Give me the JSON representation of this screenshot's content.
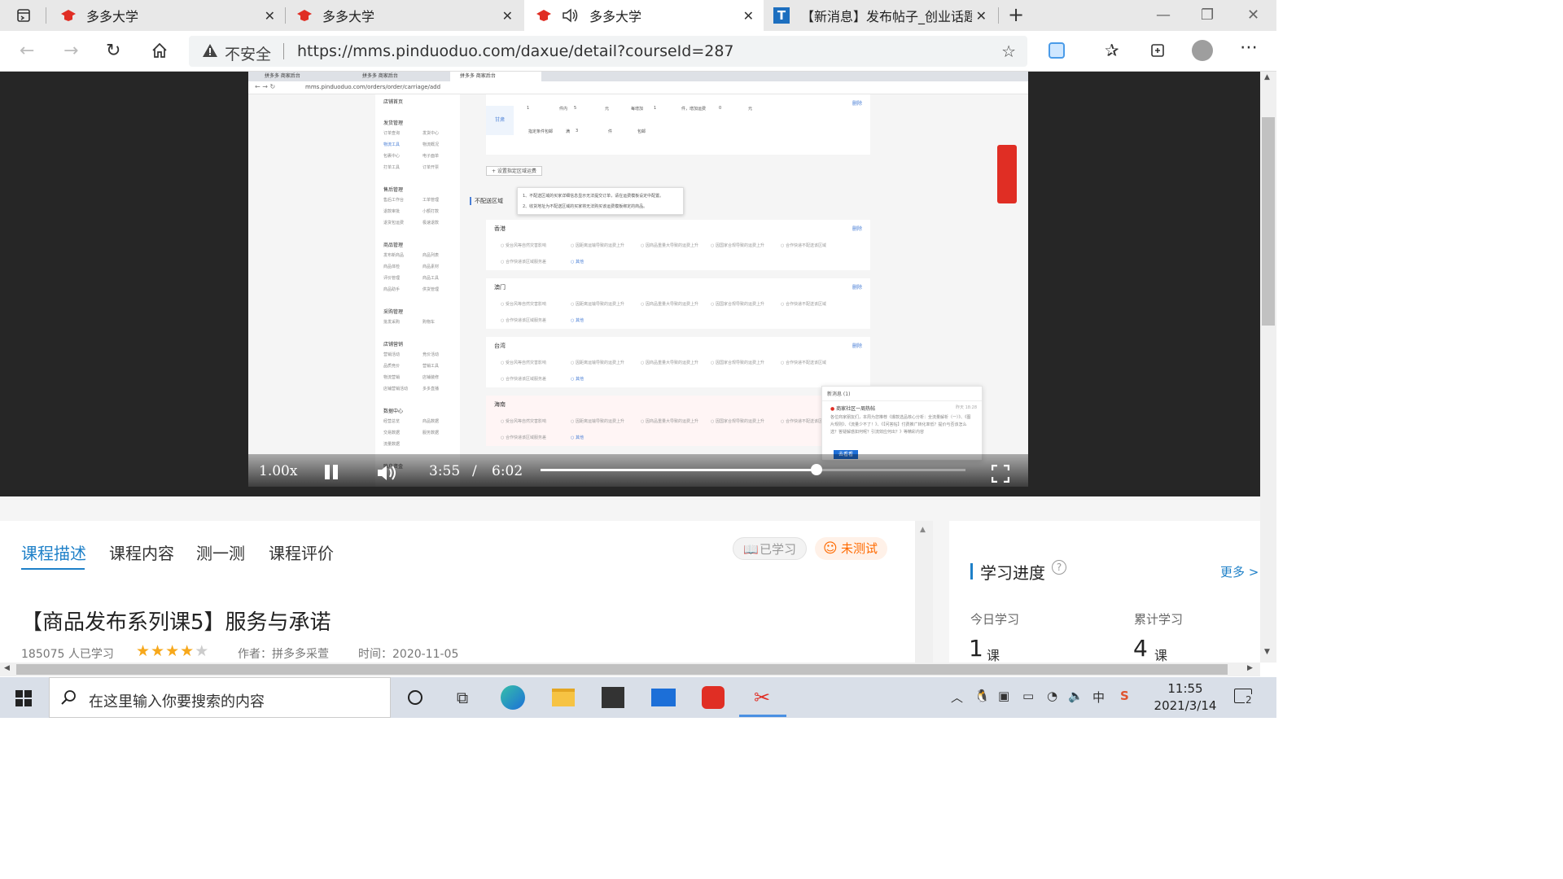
{
  "browser": {
    "tabs": [
      {
        "title": "多多大学",
        "active": false
      },
      {
        "title": "多多大学",
        "active": false
      },
      {
        "title": "多多大学",
        "active": true,
        "audio": true
      },
      {
        "title": "【新消息】发布帖子_创业话题_|",
        "active": false
      }
    ],
    "security_label": "不安全",
    "url": "https://mms.pinduoduo.com/daxue/detail?courseId=287"
  },
  "video": {
    "speed": "1.00x",
    "current_time": "3:55",
    "separator": "/",
    "duration": "6:02",
    "progress": 0.65,
    "screenshot": {
      "tabs": [
        "拼多多 商家后台",
        "拼多多 商家后台",
        "拼多多 商家后台"
      ],
      "url": "mms.pinduoduo.com/orders/order/carriage/add",
      "sidebar": [
        {
          "heading": "店铺首页",
          "items": []
        },
        {
          "heading": "发货管理",
          "items": [
            "订单查询",
            "发货中心",
            "物流工具",
            "物流概况",
            "包裹中心",
            "电子面单",
            "打单工具",
            "订单开票"
          ]
        },
        {
          "heading": "售后管理",
          "items": [
            "售后工作台",
            "工单管理",
            "退款审批",
            "小额打款",
            "退货包运费",
            "极速退款"
          ]
        },
        {
          "heading": "商品管理",
          "items": [
            "发布新商品",
            "商品列表",
            "商品体检",
            "商品素材",
            "评价管理",
            "商品工具",
            "商品助手",
            "供货管理"
          ]
        },
        {
          "heading": "采购管理",
          "items": [
            "批发采购",
            "购物车"
          ]
        },
        {
          "heading": "店铺营销",
          "items": [
            "营销活动",
            "竞价活动",
            "品质竞价",
            "营销工具",
            "物流营销",
            "店铺装修",
            "店铺营销活动",
            "多多直播"
          ]
        },
        {
          "heading": "数据中心",
          "items": [
            "经营总览",
            "商品数据",
            "交易数据",
            "服务数据",
            "流量数据"
          ]
        },
        {
          "heading": "账户资金",
          "items": []
        }
      ],
      "top_card": {
        "region": "甘肃",
        "piece_within": "件内",
        "each_add": "每增加",
        "piece_add_fee": "件，增加运费",
        "yuan": "元",
        "min_pieces": "1",
        "first_fee": "5",
        "add_pieces": "1",
        "add_fee": "0",
        "free_condition": "指定条件包邮",
        "full": "满",
        "full_value": "3",
        "unit": "件",
        "free_label": "包邮",
        "delete": "删除"
      },
      "add_region_button": "+ 设置指定区域运费",
      "no_delivery_label": "不配送区域",
      "tooltip": [
        "1、不配送区域的买家详细信息显示无法提交订单，请在运费模板设定中配置。",
        "2、收货地址为不配送区域的买家将无法购买该运费模板绑定的商品。"
      ],
      "options": [
        "受台风等自然灾害影响",
        "因距离运输导致的运费上升",
        "因商品重量大导致的运费上升",
        "因国家合规导致的运费上升",
        "合作快递不配送该区域",
        "合作快递该区域服务差",
        "其他"
      ],
      "regions": [
        {
          "name": "香港",
          "delete": "删除"
        },
        {
          "name": "澳门",
          "delete": "删除"
        },
        {
          "name": "台湾",
          "delete": "删除"
        },
        {
          "name": "海南",
          "delete": "删除"
        }
      ],
      "notice": {
        "title": "新消息 (1)",
        "item_title": "商家社区一周热帖",
        "item_time": "昨天 18:28",
        "body": "各位商家朋友们，本周为您推荐《爆款选品核心分析：全流量解析（一）》、《图片规则》、《流量少不了！》、《【问答帖】付费推广转化率低？提价与否该怎么选？答疑解惑如何呢？引流效应何出？》等精彩内容",
        "button": "去看看"
      }
    }
  },
  "course": {
    "tabs": [
      "课程描述",
      "课程内容",
      "测一测",
      "课程评价"
    ],
    "learned_label": "已学习",
    "test_label": "未测试",
    "title": "【商品发布系列课5】服务与承诺",
    "learners": "185075 人已学习",
    "rating": 4,
    "author": "作者：拼多多采萱",
    "time": "时间：2020-11-05"
  },
  "progress_panel": {
    "title": "学习进度",
    "more": "更多 >",
    "today_label": "今日学习",
    "today_value": "1",
    "today_unit": "课",
    "total_label": "累计学习",
    "total_value": "4",
    "total_unit": "课"
  },
  "taskbar": {
    "search_text": "在这里输入你要搜索的内容",
    "ime": "中",
    "time": "11:55",
    "date": "2021/3/14",
    "notification_count": "2"
  },
  "colors": {
    "accent": "#1e80c8",
    "pdd_red": "#e02e24",
    "orange": "#ff6a00"
  }
}
